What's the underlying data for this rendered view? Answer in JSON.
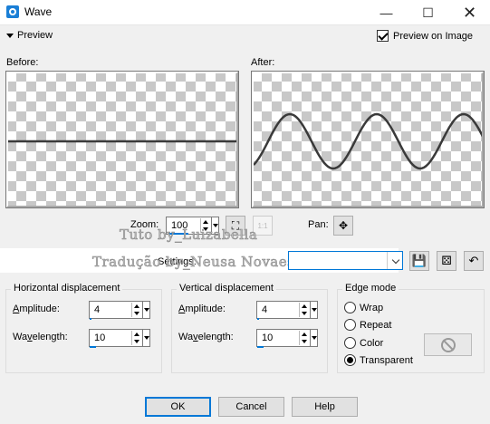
{
  "window": {
    "title": "Wave",
    "minimize_glyph": "—",
    "maximize_glyph": "☐",
    "close_glyph": "✕"
  },
  "preview": {
    "toggle_label": "Preview",
    "preview_on_image_label": "Preview on Image",
    "preview_on_image_checked": true,
    "before_label": "Before:",
    "after_label": "After:"
  },
  "zoom": {
    "label": "Zoom:",
    "value": "100",
    "pan_label": "Pan:"
  },
  "watermark": {
    "line1": "Tuto by_Luizabella",
    "line2": "Tradução by_Neusa Novaes"
  },
  "settings": {
    "label": "Settings:",
    "value": ""
  },
  "horizontal": {
    "title": "Horizontal displacement",
    "amplitude_label": "Amplitude:",
    "amplitude_value": "4",
    "wavelength_label": "Wavelength:",
    "wavelength_value": "10"
  },
  "vertical": {
    "title": "Vertical displacement",
    "amplitude_label": "Amplitude:",
    "amplitude_value": "4",
    "wavelength_label": "Wavelength:",
    "wavelength_value": "10"
  },
  "edge_mode": {
    "title": "Edge mode",
    "options": [
      "Wrap",
      "Repeat",
      "Color",
      "Transparent"
    ],
    "selected": "Transparent"
  },
  "buttons": {
    "ok": "OK",
    "cancel": "Cancel",
    "help": "Help"
  },
  "colors": {
    "accent": "#0078d7",
    "checker": "#c8c8c8",
    "line": "#3a3a3a"
  },
  "icons": {
    "app": "wave-app-icon",
    "zoom_fit": "zoom-fit-icon",
    "zoom_actual": "zoom-actual-size-icon",
    "pan": "pan-move-icon",
    "save_preset": "save-preset-icon",
    "randomize": "randomize-dice-icon",
    "reset": "reset-icon"
  }
}
